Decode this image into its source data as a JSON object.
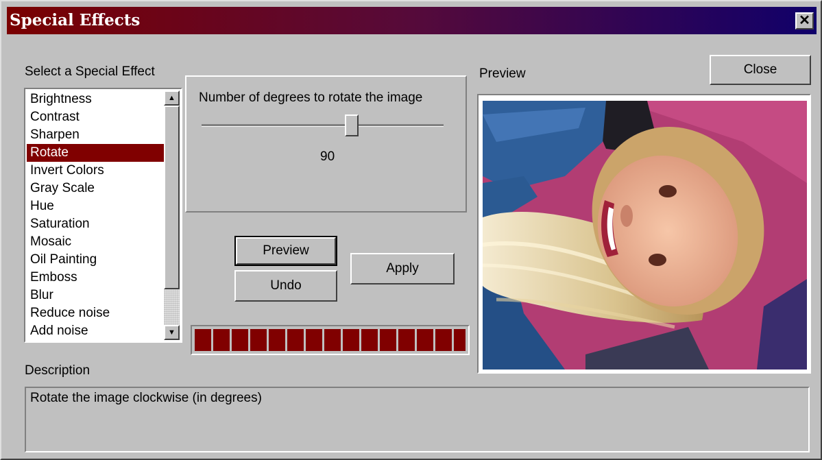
{
  "window": {
    "title": "Special Effects",
    "close_glyph": "✕"
  },
  "effects": {
    "label": "Select a Special Effect",
    "items": [
      "Brightness",
      "Contrast",
      "Sharpen",
      "Rotate",
      "Invert Colors",
      "Gray Scale",
      "Hue",
      "Saturation",
      "Mosaic",
      "Oil Painting",
      "Emboss",
      "Blur",
      "Reduce noise",
      "Add noise"
    ],
    "selected_index": 3
  },
  "parameter": {
    "label": "Number of degrees to rotate the image",
    "value": "90",
    "slider_fraction": 0.62
  },
  "buttons": {
    "preview": "Preview",
    "undo": "Undo",
    "apply": "Apply",
    "close": "Close"
  },
  "progress": {
    "percent": 100,
    "color": "#800000"
  },
  "preview": {
    "label": "Preview"
  },
  "description": {
    "label": "Description",
    "text": "Rotate the image clockwise (in degrees)"
  },
  "colors": {
    "title_start": "#7a0000",
    "title_end": "#10006a",
    "selection": "#800000",
    "face": "#c0c0c0"
  },
  "icons": {
    "scroll_up": "▲",
    "scroll_down": "▼"
  }
}
